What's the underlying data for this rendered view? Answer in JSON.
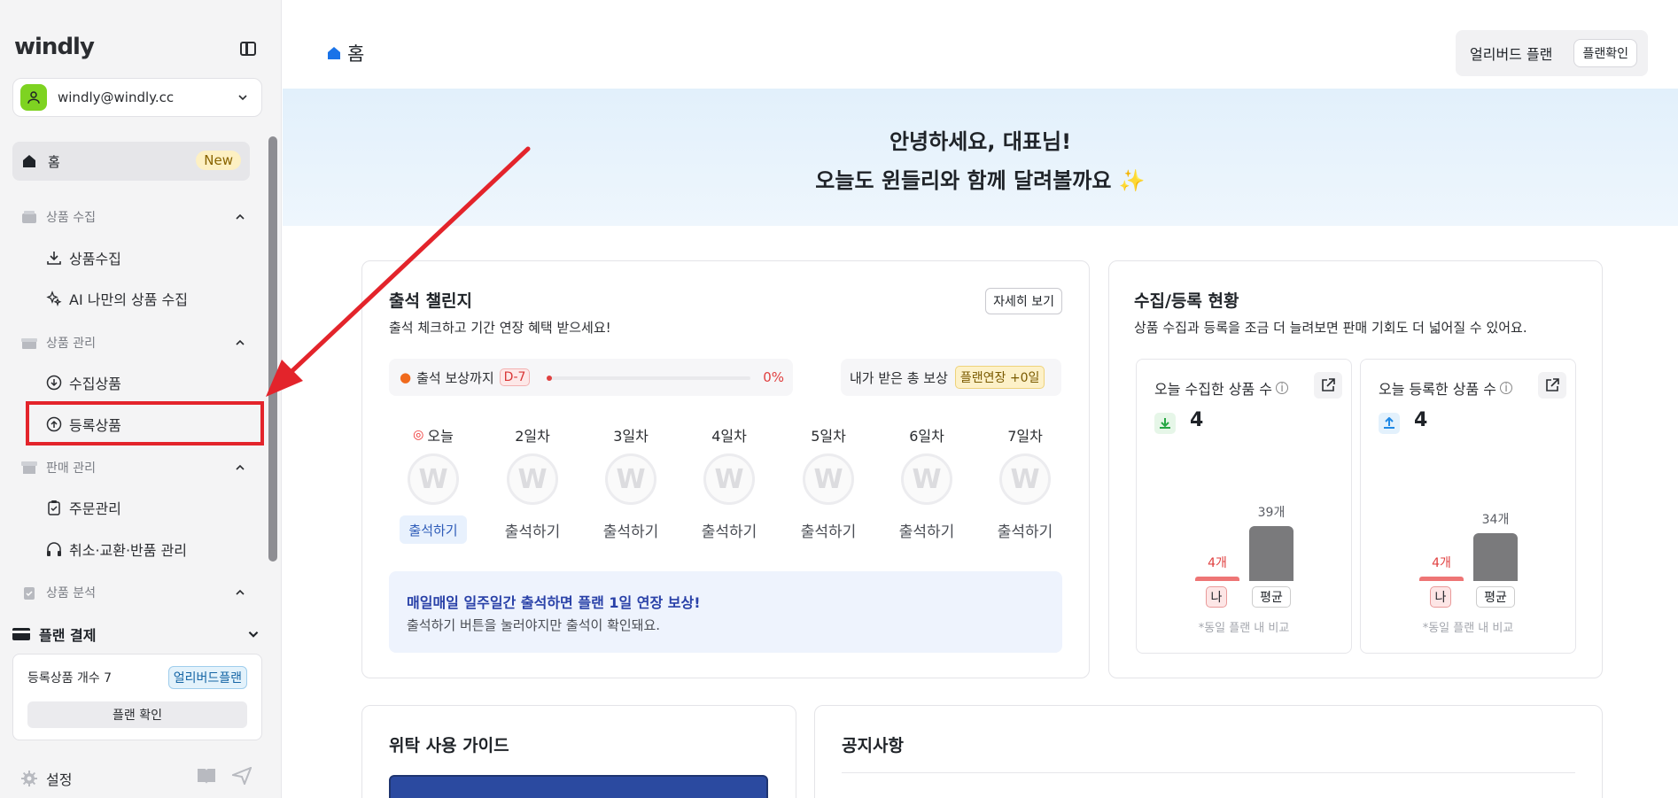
{
  "sidebar": {
    "logo": "windly",
    "account_email": "windly@windly.cc",
    "home_label": "홈",
    "home_badge": "New",
    "sections": {
      "collect": {
        "label": "상품 수집",
        "items": [
          "상품수집",
          "AI 나만의 상품 수집"
        ]
      },
      "manage": {
        "label": "상품 관리",
        "items": [
          "수집상품",
          "등록상품"
        ]
      },
      "sales": {
        "label": "판매 관리",
        "items": [
          "주문관리",
          "취소·교환·반품 관리"
        ]
      },
      "analysis": {
        "label": "상품 분석"
      }
    },
    "plan_payment_label": "플랜 결제",
    "plan_card": {
      "count_label": "등록상품 개수 7",
      "plan_badge": "얼리버드플랜",
      "plan_button": "플랜 확인"
    },
    "settings_label": "설정"
  },
  "header": {
    "page_title": "홈",
    "plan_name": "얼리버드 플랜",
    "plan_button": "플랜확인"
  },
  "banner": {
    "line1": "안녕하세요, 대표님!",
    "line2": "오늘도 윈들리와 함께 달려볼까요",
    "emoji": "✨"
  },
  "attendance": {
    "title": "출석 챌린지",
    "subtitle": "출석 체크하고 기간 연장 혜택 받으세요!",
    "more_button": "자세히 보기",
    "reward_label": "출석 보상까지",
    "dday": "D-7",
    "progress_text": "0%",
    "progress": 0,
    "total_reward_label": "내가 받은 총 보상",
    "total_reward_badge": "플랜연장 +0일",
    "days": [
      {
        "label": "오늘",
        "action": "출석하기",
        "today": true
      },
      {
        "label": "2일차",
        "action": "출석하기"
      },
      {
        "label": "3일차",
        "action": "출석하기"
      },
      {
        "label": "4일차",
        "action": "출석하기"
      },
      {
        "label": "5일차",
        "action": "출석하기"
      },
      {
        "label": "6일차",
        "action": "출석하기"
      },
      {
        "label": "7일차",
        "action": "출석하기"
      }
    ],
    "coin_letter": "W",
    "info_title": "매일매일 일주일간 출석하면 플랜 1일 연장 보상!",
    "info_text": "출석하기 버튼을 눌러야지만 출석이 확인돼요."
  },
  "status": {
    "title": "수집/등록 현황",
    "subtitle": "상품 수집과 등록을 조금 더 늘려보면 판매 기회도 더 넓어질 수 있어요.",
    "collected": {
      "title": "오늘 수집한 상품 수",
      "value": "4",
      "me_label": "4개",
      "avg_label": "39개",
      "me_value": 4,
      "avg_value": 39,
      "x_me": "나",
      "x_avg": "평균",
      "note": "*동일 플랜 내 비교"
    },
    "registered": {
      "title": "오늘 등록한 상품 수",
      "value": "4",
      "me_label": "4개",
      "avg_label": "34개",
      "me_value": 4,
      "avg_value": 34,
      "x_me": "나",
      "x_avg": "평균",
      "note": "*동일 플랜 내 비교"
    }
  },
  "guide": {
    "title": "위탁 사용 가이드"
  },
  "notice": {
    "title": "공지사항"
  },
  "colors": {
    "accent": "#2d5bb8",
    "highlight": "#e3242b",
    "avg_bar": "#7a7a7c",
    "me_bar": "#ee7575"
  }
}
